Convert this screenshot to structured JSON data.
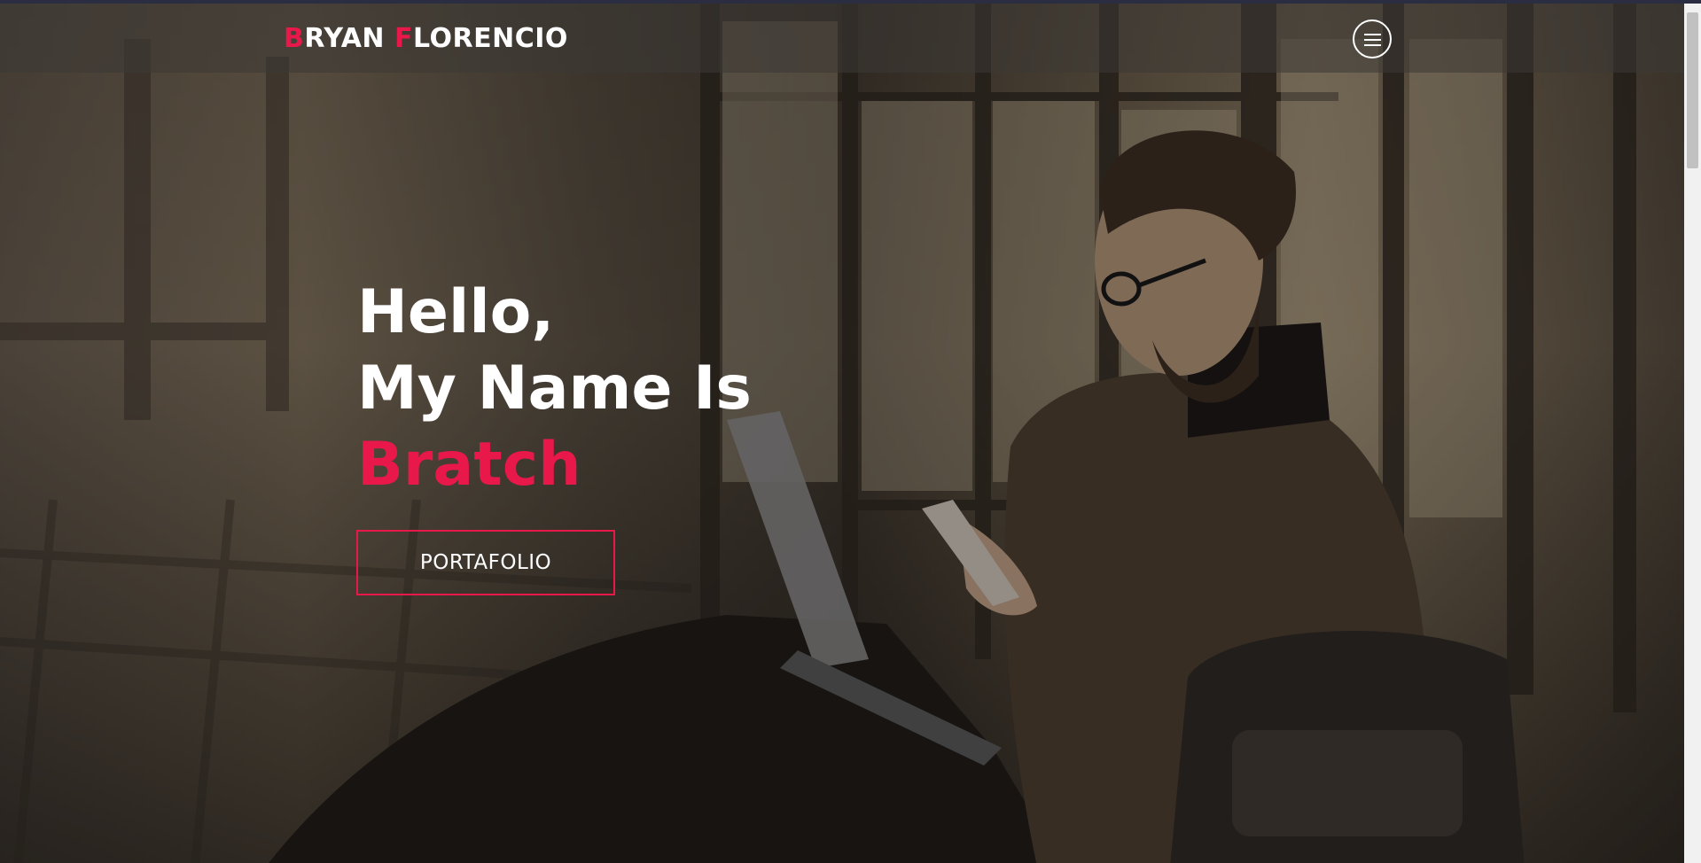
{
  "brand": {
    "first_initial": "B",
    "first_rest": "RYAN ",
    "last_initial": "F",
    "last_rest": "LORENCIO"
  },
  "hero": {
    "line1": "Hello,",
    "line2": "My Name Is",
    "name": "Bratch",
    "cta_label": "PORTAFOLIO"
  },
  "menu": {
    "icon": "hamburger-menu-icon"
  },
  "colors": {
    "accent": "#e8184a",
    "text": "#ffffff",
    "navbar": "#3c3834"
  }
}
